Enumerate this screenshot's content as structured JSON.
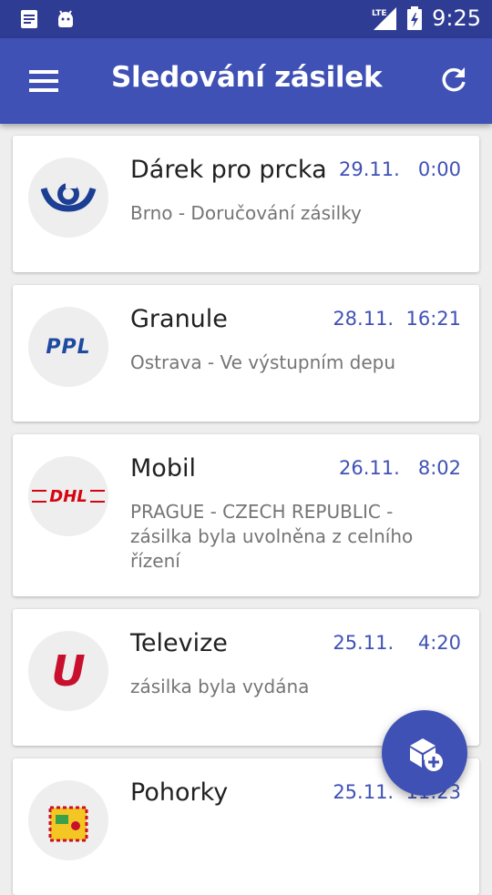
{
  "status_bar": {
    "time": "9:25",
    "network": "LTE",
    "icons": [
      "notes-icon",
      "android-icon",
      "lte-signal-icon",
      "battery-icon"
    ]
  },
  "app_bar": {
    "title": "Sledování zásilek",
    "menu_icon": "hamburger-menu-icon",
    "refresh_icon": "refresh-icon"
  },
  "shipments": [
    {
      "name": "Dárek pro prcka",
      "date": "29.11.",
      "time": "0:00",
      "status": "Brno - Doručování zásilky",
      "carrier_logo": "ceska-posta-logo"
    },
    {
      "name": "Granule",
      "date": "28.11.",
      "time": "16:21",
      "status": "Ostrava - Ve výstupním depu",
      "carrier_logo": "ppl-logo",
      "logo_text": "PPL"
    },
    {
      "name": "Mobil",
      "date": "26.11.",
      "time": "8:02",
      "status": "PRAGUE - CZECH REPUBLIC - zásilka byla uvolněna z celního řízení",
      "carrier_logo": "dhl-logo",
      "logo_text": "DHL"
    },
    {
      "name": "Televize",
      "date": "25.11.",
      "time": "4:20",
      "status": "zásilka byla vydána",
      "carrier_logo": "ulozenka-logo",
      "logo_text": "U"
    },
    {
      "name": "Pohorky",
      "date": "25.11.",
      "time": "11:23",
      "status": "",
      "carrier_logo": "parcel-box-logo"
    }
  ],
  "fab": {
    "icon": "add-package-icon"
  },
  "colors": {
    "status_bar": "#2f3c93",
    "app_bar": "#3f51b5",
    "accent": "#3f51b5",
    "dhl_red": "#d40511",
    "ppl_blue": "#1e4ba0",
    "posta_blue": "#1c3f94"
  }
}
